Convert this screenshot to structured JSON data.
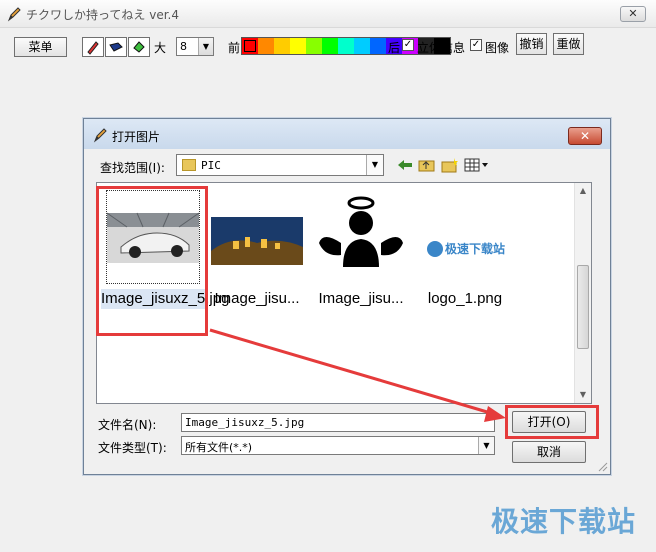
{
  "window": {
    "title": "チクワしか持ってねえ ver.4",
    "close_label": "✕"
  },
  "toolbar": {
    "menu_label": "菜单",
    "size_label": "大",
    "size_value": "8",
    "front_label": "前",
    "back_label": "后",
    "stereo_label": "立体信息",
    "image_label": "图像",
    "undo_label": "撤销",
    "redo_label": "重做",
    "palette": [
      "#ff0000",
      "#ff8800",
      "#ffcc00",
      "#ffff00",
      "#88ff00",
      "#00ff00",
      "#00ffcc",
      "#00ccff",
      "#0066ff",
      "#4400ff",
      "#cc00ff",
      "#222222",
      "#000000"
    ]
  },
  "dialog": {
    "title": "打开图片",
    "close_label": "✕",
    "lookin_label": "查找范围(I):",
    "lookin_value": "PIC",
    "files": [
      {
        "name": "Image_jisuxz_5.jpg",
        "selected": true
      },
      {
        "name": "Image_jisu..."
      },
      {
        "name": "Image_jisu..."
      },
      {
        "name": "logo_1.png"
      }
    ],
    "filename_label": "文件名(N):",
    "filename_value": "Image_jisuxz_5.jpg",
    "filetype_label": "文件类型(T):",
    "filetype_value": "所有文件(*.*)",
    "open_label": "打开(O)",
    "cancel_label": "取消",
    "logo_text": "极速下载站"
  },
  "watermark": "极速下载站"
}
